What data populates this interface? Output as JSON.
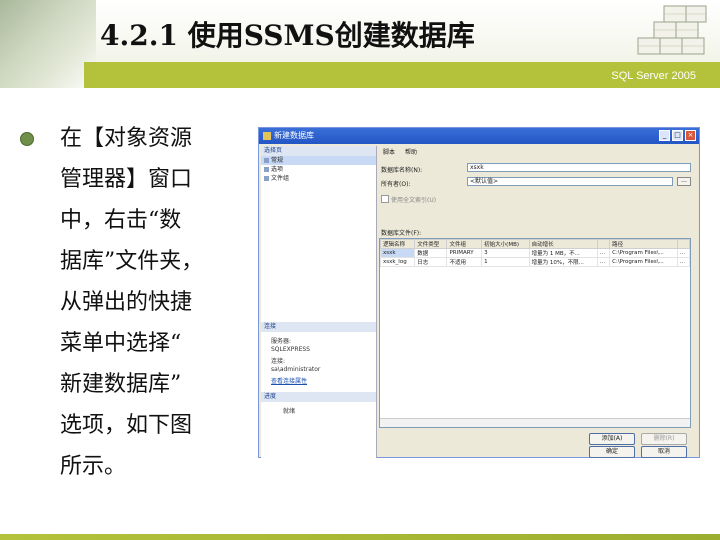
{
  "header": {
    "title": "4.2.1  使用SSMS创建数据库",
    "subtitle": "SQL Server 2005"
  },
  "bullet": {
    "lines": [
      "在【对象资源",
      "管理器】窗口",
      "中，右击“数",
      "据库”文件夹，",
      "从弹出的快捷",
      "菜单中选择“",
      "新建数据库”",
      "选项，如下图",
      "所示。"
    ]
  },
  "dialog": {
    "title": "新建数据库",
    "left": {
      "select_page_header": "选择页",
      "pages": [
        "常规",
        "选项",
        "文件组"
      ],
      "connection_header": "连接",
      "server_label": "服务器:",
      "server_value": "SQLEXPRESS",
      "conn_label": "连接:",
      "conn_value": "sa\\administrator",
      "view_conn_link": "查看连接属性",
      "progress_header": "进度",
      "progress_status": "就绪"
    },
    "toolbar": {
      "script": "脚本",
      "help": "帮助"
    },
    "form": {
      "db_name_label": "数据库名称(N):",
      "db_name_value": "xsxk",
      "owner_label": "所有者(O):",
      "owner_value": "<默认值>",
      "browse": "...",
      "fulltext_label": "使用全文索引(U)",
      "files_label": "数据库文件(F):"
    },
    "grid": {
      "columns": [
        "逻辑名称",
        "文件类型",
        "文件组",
        "初始大小(MB)",
        "自动增长",
        "",
        "路径",
        ""
      ],
      "rows": [
        [
          "xsxk",
          "数据",
          "PRIMARY",
          "3",
          "增量为 1 MB，不...",
          "...",
          "C:\\Program Files\\...",
          "..."
        ],
        [
          "xsxk_log",
          "日志",
          "不适用",
          "1",
          "增量为 10%，不限...",
          "...",
          "C:\\Program Files\\...",
          "..."
        ]
      ]
    },
    "buttons": {
      "add": "添加(A)",
      "remove": "删除(R)",
      "ok": "确定",
      "cancel": "取消"
    }
  }
}
